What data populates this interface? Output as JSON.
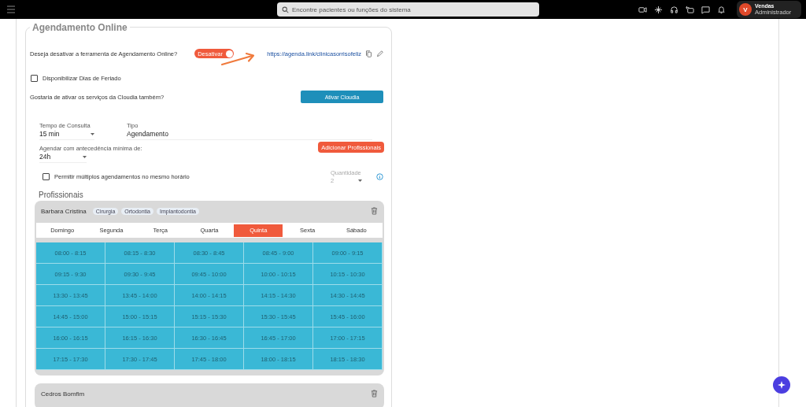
{
  "top_bar": {
    "search": {
      "placeholder": "Encontre pacientes ou funções do sistema"
    },
    "user": {
      "initial": "V",
      "name": "Vendas",
      "role": "Administrador"
    }
  },
  "online_booking": {
    "title": "Agendamento Online",
    "deactivate_question": "Deseja desativar a ferramenta de Agendamento Online?",
    "toggle": {
      "label": "Desativar",
      "on": true
    },
    "link": "https://agenda.link/clinicasorrisofeliz",
    "holidays": {
      "label": "Disponibilizar Dias de Feriado",
      "checked": false
    },
    "cloudia_question": "Gostaria de ativar os serviços da Cloudia também?",
    "cloudia_button": "Ativar Cloudia",
    "consult_time": {
      "label": "Tempo de Consulta",
      "value": "15 min"
    },
    "type": {
      "label": "Tipo",
      "value": "Agendamento"
    },
    "advance": {
      "label": "Agendar com antecedência mínima de:",
      "value": "24h"
    },
    "add_button": "Adicionar Profissionais",
    "multiple": {
      "label": "Permitir múltiplos agendamentos no mesmo horário",
      "checked": false
    },
    "quantity": {
      "label": "Quantidade",
      "value": "2",
      "disabled": true
    },
    "professionals_title": "Profissionais",
    "professionals": [
      {
        "name": "Barbara Cristina",
        "tags": [
          "Cirurgia",
          "Ortodontia",
          "Implantodontia"
        ],
        "days": [
          {
            "label": "Domingo",
            "selected": false
          },
          {
            "label": "Segunda",
            "selected": false
          },
          {
            "label": "Terça",
            "selected": false
          },
          {
            "label": "Quarta",
            "selected": false
          },
          {
            "label": "Quinta",
            "selected": true
          },
          {
            "label": "Sexta",
            "selected": false
          },
          {
            "label": "Sábado",
            "selected": false
          }
        ],
        "slots": [
          "08:00 - 8:15",
          "08:15 - 8:30",
          "08:30 - 8:45",
          "08:45 - 9:00",
          "09:00 - 9:15",
          "09:15 - 9:30",
          "09:30 - 9:45",
          "09:45 - 10:00",
          "10:00 - 10:15",
          "10:15 - 10:30",
          "13:30 - 13:45",
          "13:45 - 14:00",
          "14:00 - 14:15",
          "14:15 - 14:30",
          "14:30 - 14:45",
          "14:45 - 15:00",
          "15:00 - 15:15",
          "15:15 - 15:30",
          "15:30 - 15:45",
          "15:45 - 16:00",
          "16:00 - 16:15",
          "16:15 - 16:30",
          "16:30 - 16:45",
          "16:45 - 17:00",
          "17:00 - 17:15",
          "17:15 - 17:30",
          "17:30 - 17:45",
          "17:45 - 18:00",
          "18:00 - 18:15",
          "18:15 - 18:30"
        ]
      },
      {
        "name": "Cedros Bomfim"
      }
    ]
  }
}
